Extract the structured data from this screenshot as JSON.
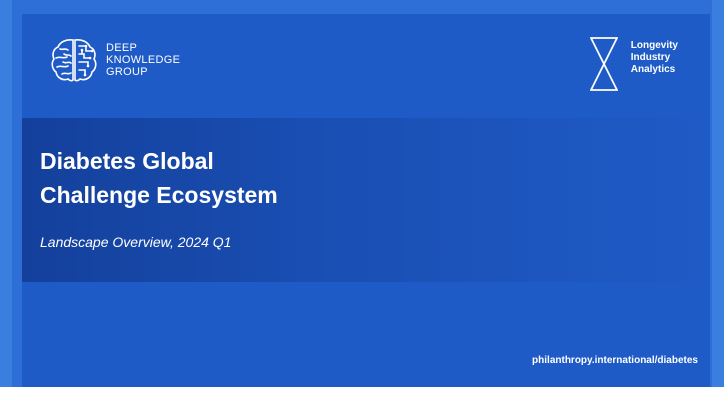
{
  "brand_left": {
    "lines": [
      "DEEP",
      "KNOWLEDGE",
      "GROUP"
    ]
  },
  "brand_right": {
    "lines": [
      "Longevity",
      "Industry",
      "Analytics"
    ]
  },
  "title": {
    "line1": "Diabetes Global",
    "line2": "Challenge Ecosystem"
  },
  "subtitle": "Landscape Overview, 2024 Q1",
  "footer": {
    "url": "philanthropy.international/diabetes"
  },
  "icons": {
    "left_logo": "brain-icon",
    "right_logo": "hourglass-icon"
  },
  "colors": {
    "slide_bg": "#1f5bc6",
    "band_dark": "#14409c",
    "text": "#ffffff"
  }
}
